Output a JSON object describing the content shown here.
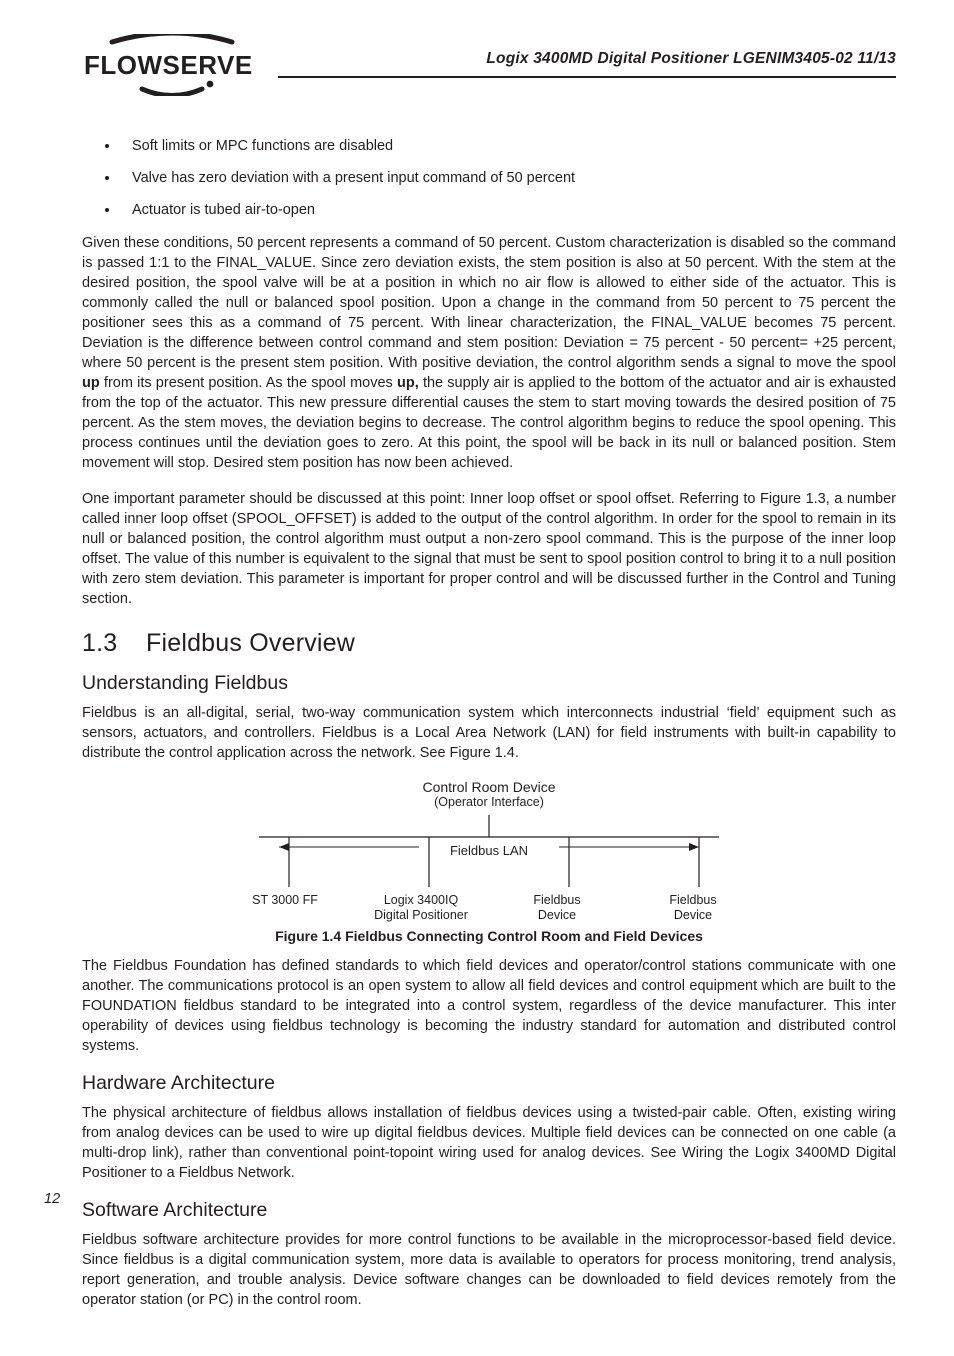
{
  "header": {
    "doc_title": "Logix 3400MD Digital Positioner LGENIM3405-02 11/13",
    "logo_text": "FLOWSERVE"
  },
  "bullets": [
    "Soft limits or MPC functions are disabled",
    "Valve has zero deviation with a present input command of 50 percent",
    "Actuator is tubed air-to-open"
  ],
  "para1_a": "Given these conditions, 50 percent represents a command of 50 percent. Custom characterization is disabled so the command is passed 1:1 to the FINAL_VALUE. Since zero deviation exists, the stem position is also at 50 percent. With the stem at the desired position, the spool valve will be at a position in which no air flow is allowed to either side of the actuator. This is commonly called the null or balanced spool position. Upon a change in the command from 50 percent to 75 percent the positioner sees this as a command of 75 percent. With linear characterization, the FINAL_VALUE becomes 75 percent. Deviation is the difference between control command and stem position: Deviation = 75 percent - 50 percent= +25 percent, where 50 percent is the present stem position. With positive deviation, the control algorithm sends a signal to move the spool ",
  "para1_up1": "up",
  "para1_b": " from its present position. As the spool moves ",
  "para1_up2": "up,",
  "para1_c": " the supply air is applied to the bottom of the actuator and air is exhausted from the top of the actuator. This new pressure differential causes the stem to start moving towards the desired position of 75 percent. As the stem moves, the deviation begins to decrease. The control algorithm begins to reduce the spool opening. This process continues until the deviation goes to zero. At this point, the spool will be back in its null or balanced position. Stem movement will stop. Desired stem position has now been achieved.",
  "para2": "One important parameter should be discussed at this point: Inner loop offset or spool offset. Referring to Figure 1.3, a number called inner loop offset (SPOOL_OFFSET) is added to the output of the control algorithm. In order for the spool to remain in its null or balanced position, the control algorithm must output a non-zero spool command. This is the purpose of the inner loop offset. The value of this number is equivalent to the signal that must be sent to spool position control to bring it to a null position with zero stem deviation. This parameter is important for proper control and will be discussed further in the Control and Tuning section.",
  "section": {
    "num": "1.3",
    "title": "Fieldbus Overview"
  },
  "sub1": "Understanding Fieldbus",
  "para3": "Fieldbus is an all-digital, serial, two-way communication system which interconnects industrial ‘field’ equipment such as sensors, actuators, and controllers. Fieldbus is a Local Area Network (LAN) for field instruments with built-in capability to distribute the control application across the network. See Figure 1.4.",
  "figure": {
    "top_label": "Control Room Device",
    "top_sub": "(Operator Interface)",
    "lan_label": "Fieldbus LAN",
    "devices": [
      {
        "line1": "ST 3000 FF",
        "line2": ""
      },
      {
        "line1": "Logix 3400IQ",
        "line2": "Digital Positioner"
      },
      {
        "line1": "Fieldbus",
        "line2": "Device"
      },
      {
        "line1": "Fieldbus",
        "line2": "Device"
      }
    ],
    "caption": "Figure 1.4 Fieldbus Connecting Control Room and Field Devices"
  },
  "para4": "The Fieldbus Foundation has defined standards to which field devices and operator/control stations communicate with one another. The communications protocol is an open system to allow all field devices and control equipment which are built to the FOUNDATION fieldbus standard to be integrated into a control system, regardless of the device manufacturer. This inter operability of devices using fieldbus technology is becoming the industry standard for automation and distributed control systems.",
  "sub2": "Hardware Architecture",
  "para5": "The physical architecture of fieldbus allows installation of fieldbus devices using a twisted-pair cable. Often, existing wiring from analog devices can be used to wire up digital fieldbus devices. Multiple field devices can be connected on one cable (a multi-drop link), rather than conventional point-topoint wiring used for analog devices. See Wiring the Logix 3400MD Digital Positioner to a Fieldbus Network.",
  "sub3": "Software Architecture",
  "para6": "Fieldbus software architecture provides for more control functions to be available in the microprocessor-based field device. Since fieldbus is a digital communication system, more data is available to operators for process monitoring, trend analysis, report generation, and trouble analysis. Device software changes can be downloaded to field devices remotely from the operator station (or PC) in the control room.",
  "page_number": "12"
}
